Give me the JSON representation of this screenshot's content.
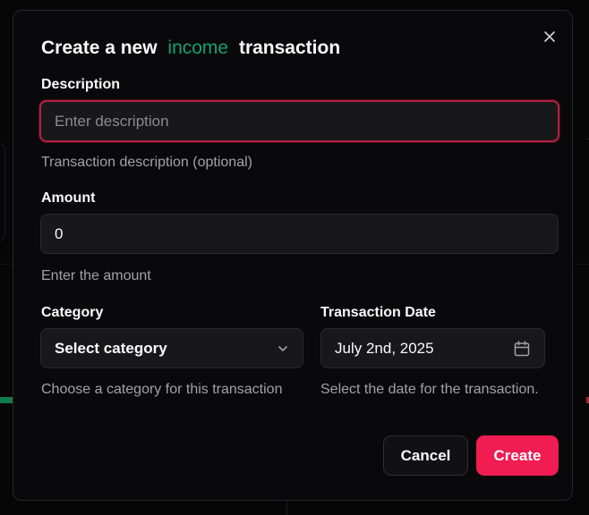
{
  "dialog": {
    "title_prefix": "Create a new",
    "title_type": "income",
    "title_suffix": "transaction",
    "accent_color": "#16a070"
  },
  "description": {
    "label": "Description",
    "value": "",
    "placeholder": "Enter description",
    "hint": "Transaction description (optional)"
  },
  "amount": {
    "label": "Amount",
    "value": "0",
    "hint": "Enter the amount"
  },
  "category": {
    "label": "Category",
    "selected": "Select category",
    "hint": "Choose a category for this transaction"
  },
  "date": {
    "label": "Transaction Date",
    "value": "July 2nd, 2025",
    "hint": "Select the date for the transaction."
  },
  "actions": {
    "cancel_label": "Cancel",
    "create_label": "Create",
    "create_color": "#f01c52"
  },
  "icons": {
    "close": "close-icon",
    "chevron": "chevron-down-icon",
    "calendar": "calendar-icon"
  }
}
